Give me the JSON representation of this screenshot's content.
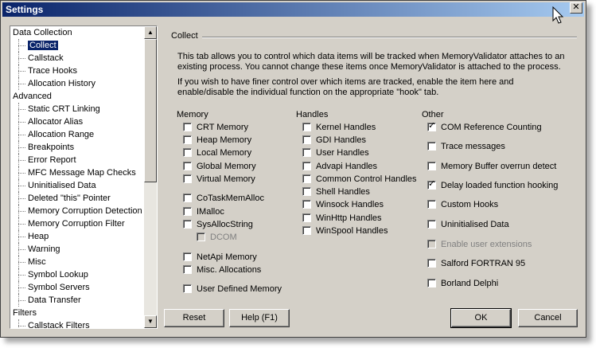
{
  "window": {
    "title": "Settings",
    "close_label": "✕"
  },
  "tree": {
    "items": [
      {
        "label": "Data Collection",
        "level": 0
      },
      {
        "label": "Collect",
        "level": 1,
        "selected": true
      },
      {
        "label": "Callstack",
        "level": 1
      },
      {
        "label": "Trace Hooks",
        "level": 1
      },
      {
        "label": "Allocation History",
        "level": 1
      },
      {
        "label": "Advanced",
        "level": 0
      },
      {
        "label": "Static CRT Linking",
        "level": 1
      },
      {
        "label": "Allocator Alias",
        "level": 1
      },
      {
        "label": "Allocation Range",
        "level": 1
      },
      {
        "label": "Breakpoints",
        "level": 1
      },
      {
        "label": "Error Report",
        "level": 1
      },
      {
        "label": "MFC Message Map Checks",
        "level": 1
      },
      {
        "label": "Uninitialised Data",
        "level": 1
      },
      {
        "label": "Deleted \"this\" Pointer",
        "level": 1
      },
      {
        "label": "Memory Corruption Detection",
        "level": 1
      },
      {
        "label": "Memory Corruption Filter",
        "level": 1
      },
      {
        "label": "Heap",
        "level": 1
      },
      {
        "label": "Warning",
        "level": 1
      },
      {
        "label": "Misc",
        "level": 1
      },
      {
        "label": "Symbol Lookup",
        "level": 1
      },
      {
        "label": "Symbol Servers",
        "level": 1
      },
      {
        "label": "Data Transfer",
        "level": 1
      },
      {
        "label": "Filters",
        "level": 0
      },
      {
        "label": "Callstack Filters",
        "level": 1
      }
    ]
  },
  "panel": {
    "title": "Collect",
    "desc1": "This tab allows you to control which data items will be tracked when MemoryValidator attaches to an existing process. You cannot change these items once MemoryValidator is attached to the process.",
    "desc2": "If you wish to have finer control over which items are tracked, enable the item here and enable/disable the individual function on the appropriate \"hook\" tab."
  },
  "memory": {
    "title": "Memory",
    "items": [
      {
        "label": "CRT Memory",
        "checked": false
      },
      {
        "label": "Heap Memory",
        "checked": false
      },
      {
        "label": "Local Memory",
        "checked": false
      },
      {
        "label": "Global Memory",
        "checked": false
      },
      {
        "label": "Virtual Memory",
        "checked": false
      },
      {
        "label": "CoTaskMemAlloc",
        "checked": false
      },
      {
        "label": "IMalloc",
        "checked": false
      },
      {
        "label": "SysAllocString",
        "checked": false
      },
      {
        "label": "DCOM",
        "checked": false,
        "disabled": true
      },
      {
        "label": "NetApi Memory",
        "checked": false
      },
      {
        "label": "Misc. Allocations",
        "checked": false
      },
      {
        "label": "User Defined Memory",
        "checked": false
      }
    ]
  },
  "handles": {
    "title": "Handles",
    "items": [
      {
        "label": "Kernel Handles",
        "checked": false
      },
      {
        "label": "GDI Handles",
        "checked": false
      },
      {
        "label": "User Handles",
        "checked": false
      },
      {
        "label": "Advapi Handles",
        "checked": false
      },
      {
        "label": "Common Control Handles",
        "checked": false
      },
      {
        "label": "Shell Handles",
        "checked": false
      },
      {
        "label": "Winsock Handles",
        "checked": false
      },
      {
        "label": "WinHttp Handles",
        "checked": false
      },
      {
        "label": "WinSpool Handles",
        "checked": false
      }
    ]
  },
  "other": {
    "title": "Other",
    "items": [
      {
        "label": "COM Reference Counting",
        "checked": true
      },
      {
        "label": "Trace messages",
        "checked": false
      },
      {
        "label": "Memory Buffer overrun detect",
        "checked": false
      },
      {
        "label": "Delay loaded function hooking",
        "checked": true
      },
      {
        "label": "Custom Hooks",
        "checked": false
      },
      {
        "label": "Uninitialised Data",
        "checked": false
      },
      {
        "label": "Enable user extensions",
        "checked": false,
        "disabled": true
      },
      {
        "label": "Salford FORTRAN 95",
        "checked": false
      },
      {
        "label": "Borland Delphi",
        "checked": false
      }
    ]
  },
  "buttons": {
    "reset": "Reset",
    "help": "Help (F1)",
    "ok": "OK",
    "cancel": "Cancel"
  }
}
